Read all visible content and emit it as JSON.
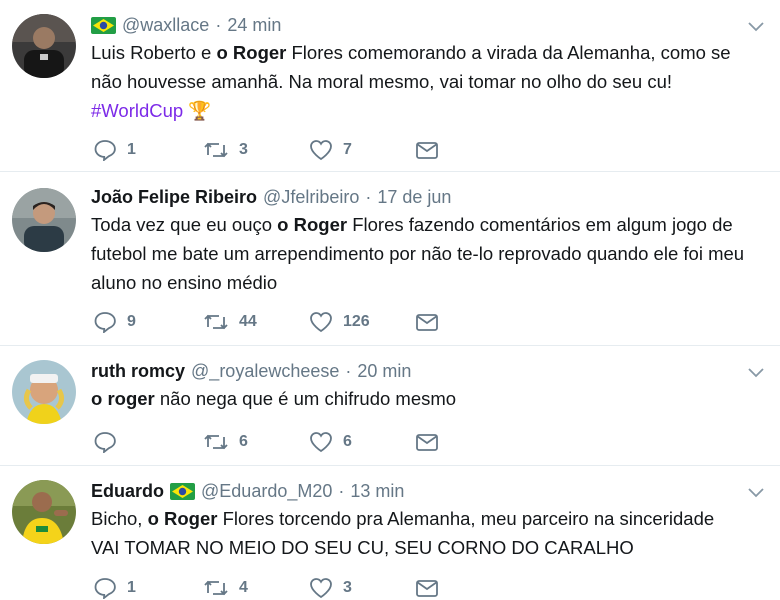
{
  "tweets": [
    {
      "name": "",
      "flag": "brazil-flag",
      "handle": "@waxllace",
      "time": "24 min",
      "lines": [
        [
          {
            "t": "Luis Roberto e "
          },
          {
            "t": "o Roger",
            "b": true
          },
          {
            "t": " Flores comemorando a virada da Alemanha, como se"
          }
        ],
        [
          {
            "t": "não houvesse amanhã. Na moral mesmo, vai tomar no olho do seu cu!"
          }
        ],
        [
          {
            "t": "#WorldCup",
            "h": true
          },
          {
            "t": " 🏆"
          }
        ]
      ],
      "replies": "1",
      "retweets": "3",
      "likes": "7"
    },
    {
      "name": "João Felipe Ribeiro",
      "flag": "",
      "handle": "@Jfelribeiro",
      "time": "17 de jun",
      "lines": [
        [
          {
            "t": "Toda vez que eu ouço "
          },
          {
            "t": "o Roger",
            "b": true
          },
          {
            "t": " Flores fazendo comentários em algum jogo de"
          }
        ],
        [
          {
            "t": "futebol me bate um arrependimento por não te-lo reprovado quando ele foi meu"
          }
        ],
        [
          {
            "t": "aluno no ensino médio"
          }
        ]
      ],
      "replies": "9",
      "retweets": "44",
      "likes": "126"
    },
    {
      "name": "ruth romcy",
      "flag": "",
      "handle": "@_royalewcheese",
      "time": "20 min",
      "lines": [
        [
          {
            "t": "o roger",
            "b": true
          },
          {
            "t": " não nega que é um chifrudo mesmo"
          }
        ]
      ],
      "replies": "",
      "retweets": "6",
      "likes": "6"
    },
    {
      "name": "Eduardo",
      "flag": "brazil-flag",
      "handle": "@Eduardo_M20",
      "time": "13 min",
      "lines": [
        [
          {
            "t": "Bicho, "
          },
          {
            "t": "o Roger",
            "b": true
          },
          {
            "t": " Flores torcendo pra Alemanha, meu parceiro na sinceridade"
          }
        ],
        [
          {
            "t": "VAI TOMAR NO MEIO DO SEU CU, SEU CORNO DO CARALHO"
          }
        ]
      ],
      "replies": "1",
      "retweets": "4",
      "likes": "3"
    }
  ],
  "colors": {
    "text": "#14171a",
    "muted": "#657786",
    "hashtag": "#7c2ae8",
    "divider": "#e6ecf0"
  },
  "icons": [
    "reply-icon",
    "retweet-icon",
    "like-icon",
    "direct-message-icon",
    "chevron-down-icon"
  ]
}
